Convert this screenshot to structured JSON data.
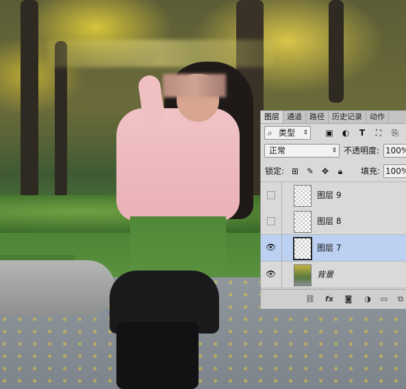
{
  "layers_panel": {
    "tabs": [
      "图层",
      "通道",
      "路径",
      "历史记录",
      "动作"
    ],
    "filter": {
      "icon": "search-icon",
      "value": "类型"
    },
    "filter_icons": [
      "image-filter-icon",
      "adjustment-filter-icon",
      "type-filter-icon",
      "shape-filter-icon",
      "smart-object-filter-icon"
    ],
    "blend_mode": "正常",
    "opacity_label": "不透明度:",
    "opacity_value": "100%",
    "lock_label": "锁定:",
    "lock_icons": [
      "lock-transparent-icon",
      "lock-brush-icon",
      "lock-move-icon",
      "lock-all-icon"
    ],
    "fill_label": "填充:",
    "fill_value": "100%",
    "layers": [
      {
        "name": "图层 9",
        "visible": false,
        "selected": false
      },
      {
        "name": "图层 8",
        "visible": false,
        "selected": false
      },
      {
        "name": "图层 7",
        "visible": true,
        "selected": true
      },
      {
        "name": "背景",
        "visible": true,
        "selected": false
      }
    ],
    "bottom_icons": [
      "link-icon",
      "fx-icon",
      "mask-icon",
      "adjustment-icon",
      "folder-icon",
      "new-layer-icon"
    ],
    "fx_label": "fx"
  },
  "colors": {
    "panel_bg": "#d9d9d9",
    "selected_layer": "#bcd0f2"
  }
}
